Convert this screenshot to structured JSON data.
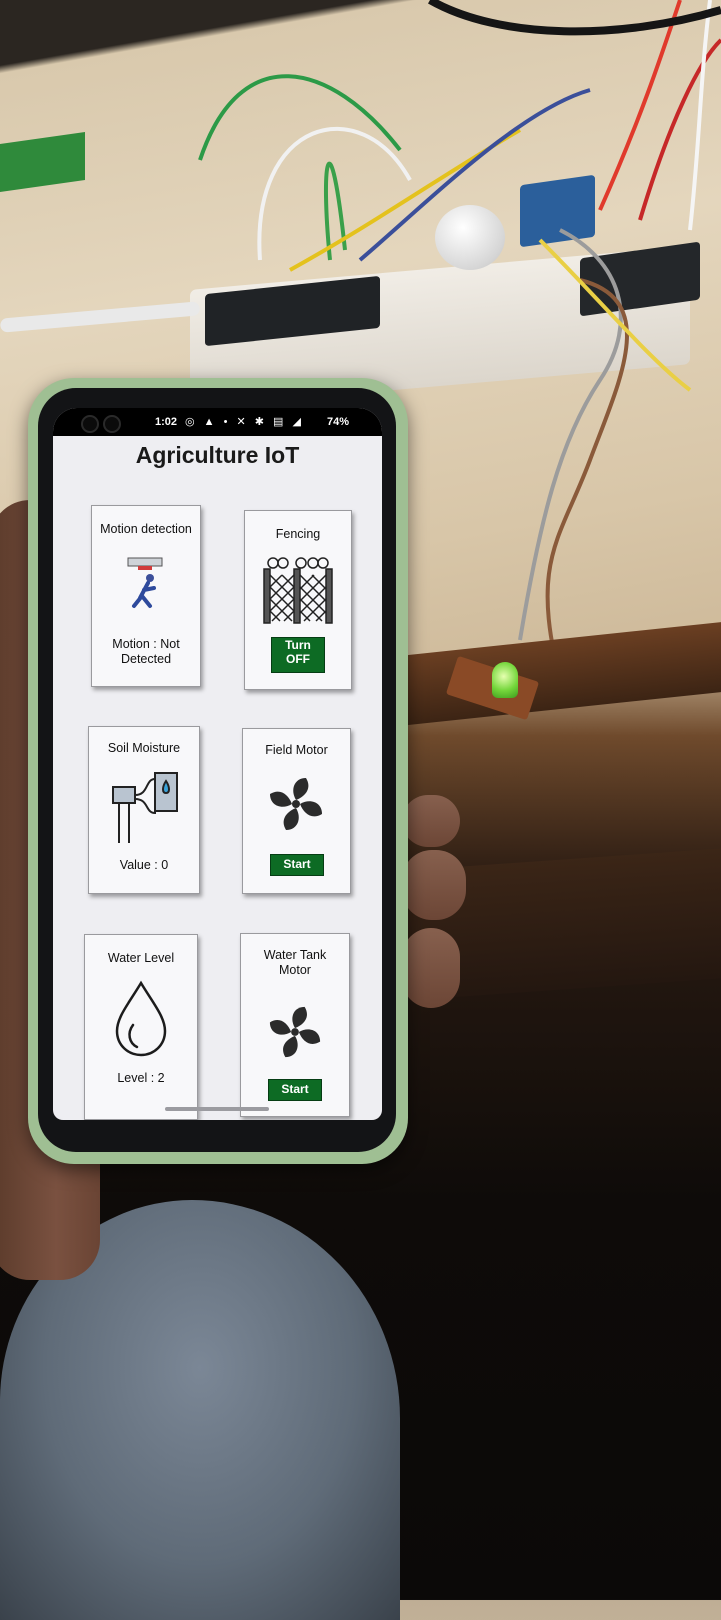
{
  "status_bar": {
    "time": "1:02",
    "icons": "◎ ▲ • ✕ ✱ ▤ ◢",
    "battery": "74%"
  },
  "app": {
    "title": "Agriculture IoT"
  },
  "cards": {
    "motion": {
      "title": "Motion detection",
      "status": "Motion : Not Detected",
      "icon": "intruder-sensor-icon"
    },
    "fencing": {
      "title": "Fencing",
      "button": "Turn OFF",
      "icon": "fence-icon"
    },
    "soil": {
      "title": "Soil Moisture",
      "status": "Value : 0",
      "icon": "soil-sensor-icon"
    },
    "field_motor": {
      "title": "Field Motor",
      "button": "Start",
      "icon": "fan-icon"
    },
    "water_level": {
      "title": "Water Level",
      "status": "Level : 2",
      "icon": "water-drop-icon"
    },
    "tank_motor": {
      "title": "Water Tank Motor",
      "button": "Start",
      "icon": "fan-icon"
    }
  },
  "colors": {
    "button_bg": "#0d6b24",
    "phone_case": "#9fbf93",
    "screen_bg": "#eeeef2",
    "led": "#74d63b"
  }
}
